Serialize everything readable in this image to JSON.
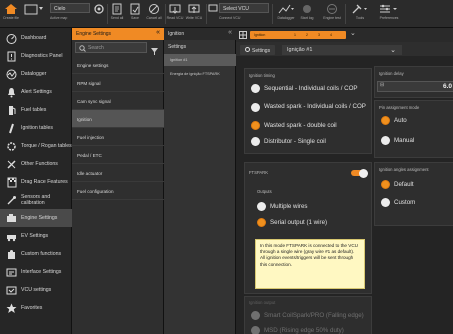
{
  "toolbar": {
    "project_name": "Cielo",
    "labels": [
      "Create file",
      "Active map",
      "Send all",
      "Save",
      "Cancel all",
      "Read VCU",
      "Write VCU",
      "Connect VCU",
      "Datalogger",
      "Start log",
      "Engine test",
      "Tools",
      "Preferences"
    ],
    "vcu_select": "Select VCU"
  },
  "sidebar": {
    "items": [
      {
        "label": "Dashboard",
        "icon": "speedometer-icon"
      },
      {
        "label": "Diagnostics Panel",
        "icon": "diagnostics-icon"
      },
      {
        "label": "Datalogger",
        "icon": "datalogger-icon"
      },
      {
        "label": "Alert Settings",
        "icon": "alert-icon"
      },
      {
        "label": "Fuel tables",
        "icon": "fuel-icon"
      },
      {
        "label": "Ignition tables",
        "icon": "spark-plug-icon"
      },
      {
        "label": "Torque / Rogan tables",
        "icon": "torque-icon"
      },
      {
        "label": "Other Functions",
        "icon": "tools-icon"
      },
      {
        "label": "Drag Race Features",
        "icon": "flag-icon"
      },
      {
        "label": "Sensors and calibration",
        "icon": "sensor-icon"
      },
      {
        "label": "Engine Settings",
        "icon": "engine-icon"
      },
      {
        "label": "EV Settings",
        "icon": "ev-icon"
      },
      {
        "label": "Custom functions",
        "icon": "puzzle-icon"
      },
      {
        "label": "Interface Settings",
        "icon": "interface-icon"
      },
      {
        "label": "VCU settings",
        "icon": "vcu-icon"
      },
      {
        "label": "Favorites",
        "icon": "star-icon"
      }
    ]
  },
  "col2": {
    "header": "Engine Settings",
    "search_placeholder": "Search",
    "items": [
      "Engine settings",
      "RPM signal",
      "Cam sync signal",
      "Ignition",
      "Fuel injection",
      "Pedal / ETC",
      "Idle actuator",
      "Fuel configuration"
    ]
  },
  "col3": {
    "header": "Ignition",
    "title": "Settings",
    "items": [
      "Ignition #1",
      "Energia de ignição FTSPARK"
    ]
  },
  "main": {
    "progress_labels": [
      "Ignition",
      "1",
      "2",
      "3",
      "4"
    ],
    "tab_settings": "Settings",
    "tab_ignition": "Ignição #1",
    "ignition_timing": {
      "title": "Ignition timing",
      "options": [
        "Sequential - Individual coils / COP",
        "Wasted spark - Individual coils / COP",
        "Wasted spark - double coil",
        "Distributor - Single coil"
      ],
      "selected": 2
    },
    "ignition_delay": {
      "title": "Ignition delay",
      "value": "6.0"
    },
    "pin_assignment": {
      "title": "Pin assignment mode",
      "options": [
        "Auto",
        "Manual"
      ],
      "selected": 0
    },
    "ftspark": {
      "title": "FTSPARK",
      "outputs_label": "Outputs",
      "options": [
        "Multiple wires",
        "Serial output (1 wire)"
      ],
      "selected": 1,
      "note": "In this mode FTSPARK is connected to the VCU through a single wire (gray wire #1 as default). All ignition events/triggers will be sent through this connection."
    },
    "angles": {
      "title": "Ignition angles assignment",
      "options": [
        "Default",
        "Custom"
      ],
      "selected": 0
    },
    "ignition_output": {
      "title": "Ignition output",
      "options": [
        "Smart CoilSpark/PRO (Falling edge)",
        "MSD (Rising edge 50% duty)"
      ]
    }
  }
}
